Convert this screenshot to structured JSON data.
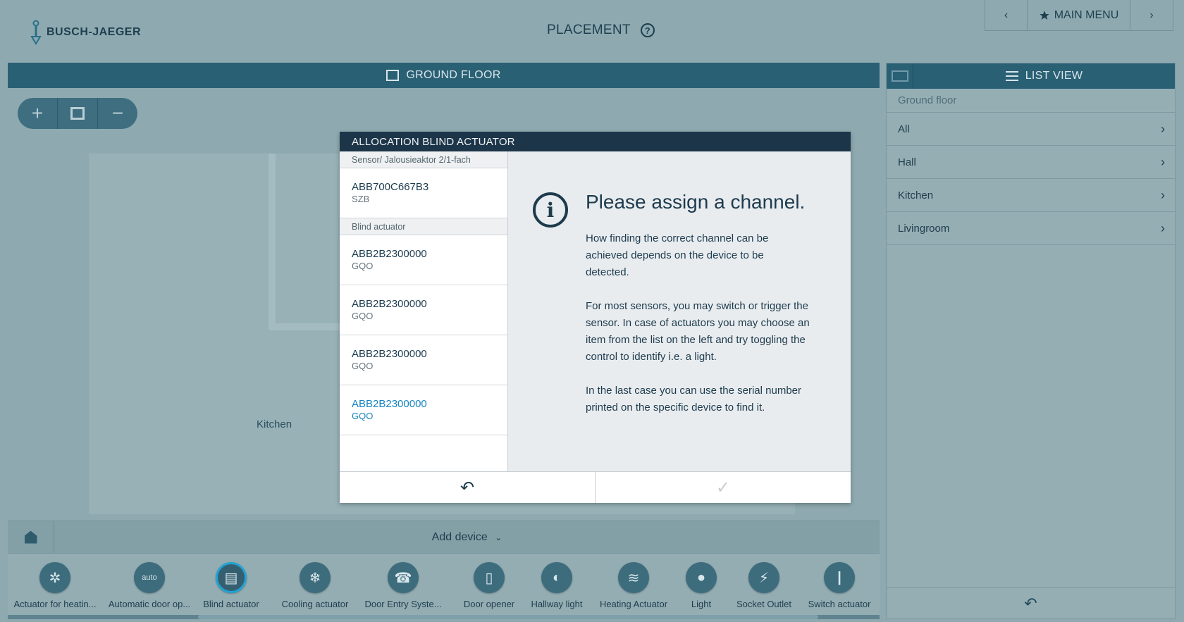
{
  "header": {
    "brand": "BUSCH-JAEGER",
    "title": "PLACEMENT",
    "help_glyph": "?",
    "nav": {
      "prev_glyph": "‹",
      "main_menu_label": "MAIN MENU",
      "next_glyph": "›"
    }
  },
  "plan": {
    "floor_title": "GROUND FLOOR",
    "zoom_in": "+",
    "zoom_out": "−",
    "room_label": "Kitchen",
    "add_device_label": "Add device",
    "devices": [
      {
        "label": "Actuator for heatin...",
        "icon": "heating-actuator-icon",
        "glyph": "✲"
      },
      {
        "label": "Automatic door op...",
        "icon": "automatic-door-icon",
        "glyph": "auto"
      },
      {
        "label": "Blind actuator",
        "icon": "blind-icon",
        "glyph": "▤"
      },
      {
        "label": "Cooling actuator",
        "icon": "snowflake-icon",
        "glyph": "❄"
      },
      {
        "label": "Door Entry Syste...",
        "icon": "door-entry-icon",
        "glyph": "☎"
      },
      {
        "label": "Door opener",
        "icon": "door-opener-icon",
        "glyph": "▯"
      },
      {
        "label": "Hallway light",
        "icon": "hallway-light-icon",
        "glyph": "◐"
      },
      {
        "label": "Heating Actuator",
        "icon": "heating-waves-icon",
        "glyph": "≋"
      },
      {
        "label": "Light",
        "icon": "bulb-icon",
        "glyph": "●"
      },
      {
        "label": "Socket Outlet",
        "icon": "socket-icon",
        "glyph": "⚡"
      },
      {
        "label": "Switch actuator",
        "icon": "switch-icon",
        "glyph": "|"
      }
    ]
  },
  "right_panel": {
    "title": "LIST VIEW",
    "subtitle": "Ground floor",
    "items": [
      {
        "label": "All"
      },
      {
        "label": "Hall"
      },
      {
        "label": "Kitchen"
      },
      {
        "label": "Livingroom"
      }
    ],
    "back_glyph": "↶"
  },
  "modal": {
    "title": "ALLOCATION BLIND ACTUATOR",
    "group1": "Sensor/ Jalousieaktor 2/1-fach",
    "group1_items": [
      {
        "id": "ABB700C667B3",
        "sub": "SZB"
      }
    ],
    "group2": "Blind actuator",
    "group2_items": [
      {
        "id": "ABB2B2300000",
        "sub": "GQO"
      },
      {
        "id": "ABB2B2300000",
        "sub": "GQO"
      },
      {
        "id": "ABB2B2300000",
        "sub": "GQO"
      },
      {
        "id": "ABB2B2300000",
        "sub": "GQO"
      }
    ],
    "info_glyph": "i",
    "heading": "Please assign a channel.",
    "p1": "How finding the correct channel can be achieved depends on the device to be detected.",
    "p2": "For most sensors, you may switch or trigger the sensor. In case of actuators you may choose an item from the list on the left and try toggling the control to identify i.e. a light.",
    "p3": "In the last case you can use the serial number printed on the specific device to find it.",
    "back_glyph": "↶",
    "confirm_glyph": "✓"
  }
}
